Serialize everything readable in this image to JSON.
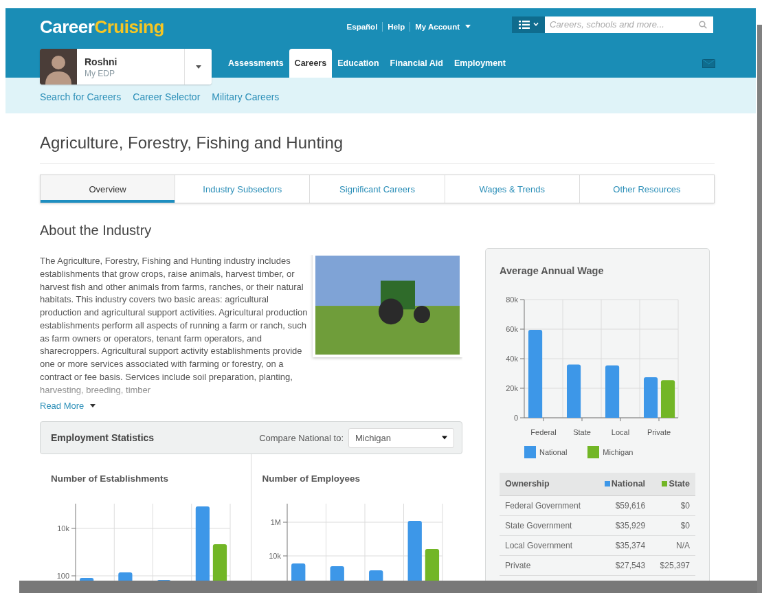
{
  "header": {
    "logo": {
      "first": "Career",
      "second": "Cruising"
    },
    "links": [
      "Español",
      "Help"
    ],
    "account": "My Account",
    "search": {
      "placeholder": "Careers, schools and more..."
    }
  },
  "profile": {
    "name": "Roshni",
    "subtitle": "My EDP"
  },
  "nav_tabs": [
    {
      "label": "Assessments",
      "selected": false
    },
    {
      "label": "Careers",
      "selected": true
    },
    {
      "label": "Education",
      "selected": false
    },
    {
      "label": "Financial Aid",
      "selected": false
    },
    {
      "label": "Employment",
      "selected": false
    }
  ],
  "subnav": [
    "Search for Careers",
    "Career Selector",
    "Military Careers"
  ],
  "page_title": "Agriculture, Forestry, Fishing and Hunting",
  "section_tabs": [
    {
      "label": "Overview",
      "selected": true
    },
    {
      "label": "Industry Subsectors",
      "selected": false
    },
    {
      "label": "Significant Careers",
      "selected": false
    },
    {
      "label": "Wages & Trends",
      "selected": false
    },
    {
      "label": "Other Resources",
      "selected": false
    }
  ],
  "about": {
    "heading": "About the Industry",
    "text": "The Agriculture, Forestry, Fishing and Hunting industry includes establishments that grow crops, raise animals, harvest timber, or harvest fish and other animals from farms, ranches, or their natural habitats. This industry covers two basic areas: agricultural production and agricultural support activities. Agricultural production establishments perform all aspects of running a farm or ranch, such as farm owners or operators, tenant farm operators, and sharecroppers. Agricultural support activity establishments provide one or more services associated with farming or forestry, on a contract or fee basis. Services include soil preparation, planting, harvesting, breeding, timber",
    "read_more": "Read More"
  },
  "employment_statistics": {
    "title": "Employment Statistics",
    "compare_label": "Compare National to:",
    "compare_value": "Michigan",
    "charts": [
      {
        "title": "Number of Establishments",
        "tick_labels": [
          "10k",
          "100"
        ]
      },
      {
        "title": "Number of Employees",
        "tick_labels": [
          "1M",
          "10k"
        ]
      }
    ]
  },
  "wage_panel": {
    "chart_data": {
      "type": "bar",
      "title": "Average Annual Wage",
      "categories": [
        "Federal",
        "State",
        "Local",
        "Private"
      ],
      "ylim": [
        0,
        80000
      ],
      "yticks": [
        {
          "value": 0,
          "label": "0"
        },
        {
          "value": 20000,
          "label": "20k"
        },
        {
          "value": 40000,
          "label": "40k"
        },
        {
          "value": 60000,
          "label": "60k"
        },
        {
          "value": 80000,
          "label": "80k"
        }
      ],
      "grid": true,
      "series": [
        {
          "name": "National",
          "color": "#3d97e8",
          "values": [
            59500,
            36000,
            35500,
            27500
          ]
        },
        {
          "name": "Michigan",
          "color": "#72b626",
          "values": [
            0,
            0,
            null,
            25500
          ]
        }
      ]
    },
    "table": {
      "columns": [
        {
          "label": "Ownership"
        },
        {
          "label": "National",
          "color": "#3d97e8"
        },
        {
          "label": "State",
          "color": "#72b626"
        }
      ],
      "rows": [
        [
          "Federal Government",
          "$59,616",
          "$0"
        ],
        [
          "State Government",
          "$35,929",
          "$0"
        ],
        [
          "Local Government",
          "$35,374",
          "N/A"
        ],
        [
          "Private",
          "$27,543",
          "$25,397"
        ]
      ]
    }
  }
}
